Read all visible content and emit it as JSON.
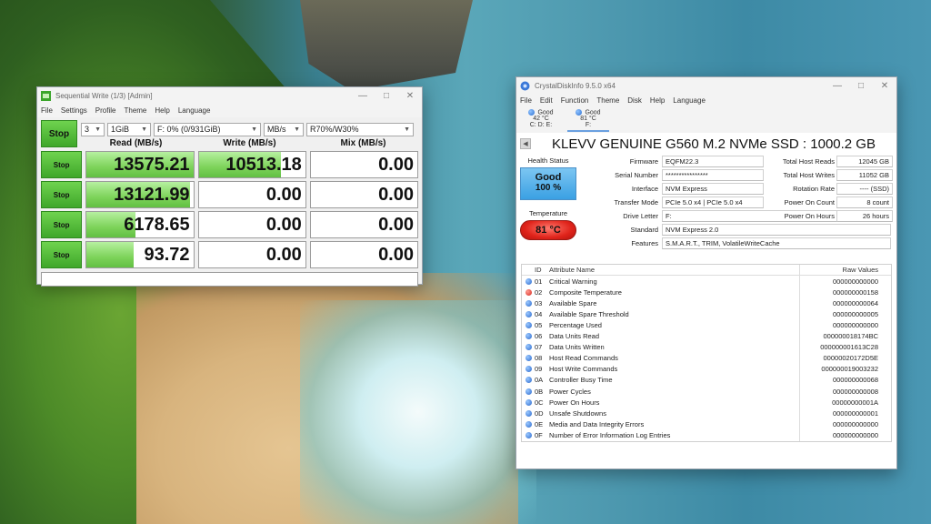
{
  "cdm": {
    "title": "Sequential Write (1/3) [Admin]",
    "menu": [
      "File",
      "Settings",
      "Profile",
      "Theme",
      "Help",
      "Language"
    ],
    "all_button": "Stop",
    "count": "3",
    "size": "1GiB",
    "drive": "F: 0% (0/931GiB)",
    "unit": "MB/s",
    "mix_ratio": "R70%/W30%",
    "headers": {
      "read": "Read (MB/s)",
      "write": "Write (MB/s)",
      "mix": "Mix (MB/s)"
    },
    "rows": [
      {
        "button": "Stop",
        "read": "13575.21",
        "read_fill": 1.0,
        "write": "10513.18",
        "write_fill": 0.77,
        "mix": "0.00"
      },
      {
        "button": "Stop",
        "read": "13121.99",
        "read_fill": 0.97,
        "write": "0.00",
        "write_fill": 0,
        "mix": "0.00"
      },
      {
        "button": "Stop",
        "read": "6178.65",
        "read_fill": 0.46,
        "write": "0.00",
        "write_fill": 0,
        "mix": "0.00"
      },
      {
        "button": "Stop",
        "read": "93.72",
        "read_fill": 0.44,
        "write": "0.00",
        "write_fill": 0,
        "mix": "0.00"
      }
    ]
  },
  "cdi": {
    "title": "CrystalDiskInfo 9.5.0 x64",
    "menu": [
      "File",
      "Edit",
      "Function",
      "Theme",
      "Disk",
      "Help",
      "Language"
    ],
    "drives": [
      {
        "status": "Good",
        "temp": "42 °C",
        "letter": "C: D: E:"
      },
      {
        "status": "Good",
        "temp": "81 °C",
        "letter": "F:"
      }
    ],
    "model": "KLEVV GENUINE G560 M.2 NVMe SSD : 1000.2 GB",
    "health_label": "Health Status",
    "health_status": "Good",
    "health_percent": "100 %",
    "temp_label": "Temperature",
    "temp_value": "81 °C",
    "labels": {
      "firmware": "Firmware",
      "serial": "Serial Number",
      "interface": "Interface",
      "transfer": "Transfer Mode",
      "drive_letter": "Drive Letter",
      "standard": "Standard",
      "features": "Features",
      "host_reads": "Total Host Reads",
      "host_writes": "Total Host Writes",
      "rotation": "Rotation Rate",
      "power_count": "Power On Count",
      "power_hours": "Power On Hours"
    },
    "values": {
      "firmware": "EQFM22.3",
      "serial": "****************",
      "interface": "NVM Express",
      "transfer": "PCIe 5.0 x4 | PCIe 5.0 x4",
      "drive_letter": "F:",
      "standard": "NVM Express 2.0",
      "features": "S.M.A.R.T., TRIM, VolatileWriteCache",
      "host_reads": "12045 GB",
      "host_writes": "11052 GB",
      "rotation": "---- (SSD)",
      "power_count": "8 count",
      "power_hours": "26 hours"
    },
    "attr_headers": {
      "id": "ID",
      "name": "Attribute Name",
      "raw": "Raw Values"
    },
    "attributes": [
      {
        "id": "01",
        "name": "Critical Warning",
        "raw": "000000000000",
        "status": "good"
      },
      {
        "id": "02",
        "name": "Composite Temperature",
        "raw": "000000000158",
        "status": "bad"
      },
      {
        "id": "03",
        "name": "Available Spare",
        "raw": "000000000064",
        "status": "good"
      },
      {
        "id": "04",
        "name": "Available Spare Threshold",
        "raw": "000000000005",
        "status": "good"
      },
      {
        "id": "05",
        "name": "Percentage Used",
        "raw": "000000000000",
        "status": "good"
      },
      {
        "id": "06",
        "name": "Data Units Read",
        "raw": "000000018174BC",
        "status": "good"
      },
      {
        "id": "07",
        "name": "Data Units Written",
        "raw": "000000001613C28",
        "status": "good"
      },
      {
        "id": "08",
        "name": "Host Read Commands",
        "raw": "00000020172D5E",
        "status": "good"
      },
      {
        "id": "09",
        "name": "Host Write Commands",
        "raw": "000000019003232",
        "status": "good"
      },
      {
        "id": "0A",
        "name": "Controller Busy Time",
        "raw": "000000000068",
        "status": "good"
      },
      {
        "id": "0B",
        "name": "Power Cycles",
        "raw": "000000000008",
        "status": "good"
      },
      {
        "id": "0C",
        "name": "Power On Hours",
        "raw": "00000000001A",
        "status": "good"
      },
      {
        "id": "0D",
        "name": "Unsafe Shutdowns",
        "raw": "000000000001",
        "status": "good"
      },
      {
        "id": "0E",
        "name": "Media and Data Integrity Errors",
        "raw": "000000000000",
        "status": "good"
      },
      {
        "id": "0F",
        "name": "Number of Error Information Log Entries",
        "raw": "000000000000",
        "status": "good"
      }
    ]
  }
}
